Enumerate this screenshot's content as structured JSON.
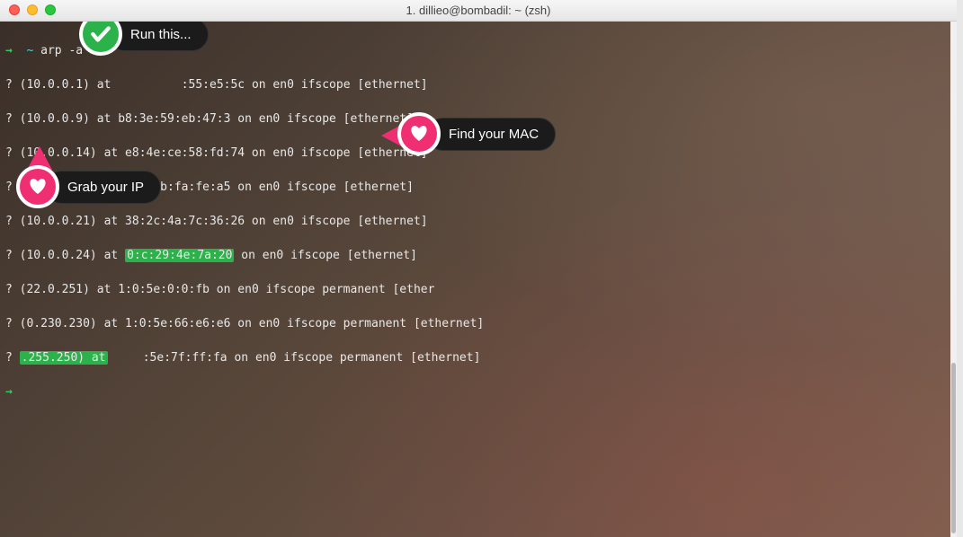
{
  "window": {
    "title": "1. dillieo@bombadil: ~ (zsh)"
  },
  "prompt": {
    "arrow": "→",
    "path": "~",
    "command": "arp -a"
  },
  "output": [
    {
      "raw": "? (10.0.0.1) at ",
      "mac": "",
      "tail": ":55:e5:5c on en0 ifscope [ethernet]"
    },
    {
      "raw": "? (10.0.0.9) at b8:3e:59:eb:47:3 on en0 ifscope [ethernet]"
    },
    {
      "raw": "? (10.0.0.14) at e8:4e:ce:58:fd:74 on en0 ifscope [ethernet]"
    },
    {
      "raw": "? (10.0.0.16) at 0:d:4b:fa:fe:a5 on en0 ifscope [ethernet]"
    },
    {
      "raw": "? (10.0.0.21) at 38:2c:4a:7c:36:26 on en0 ifscope [ethernet]"
    },
    {
      "raw": "? (10.0.0.24) at ",
      "macHl": "0:c:29:4e:7a:20",
      "tail2": " on en0 ifscope [ethernet]"
    },
    {
      "raw": "? (22",
      "ipUnder": ".0.251) at 1:0:5e:0:0:fb on en0 ifscope permanent [eth",
      "tail3": "er"
    },
    {
      "raw": "? (",
      "ipUnder2": "0.230.230) at 1:0:5e:66:e6:e6 on en0 ifscope permanent [ethernet]"
    },
    {
      "raw": "? ",
      "ipSpace": "             ",
      "tail4": ":5e:7f:ff:fa on en0 ifscope permanent [ethernet]"
    }
  ],
  "annotations": {
    "run": "Run this...",
    "mac": "Find your MAC",
    "ip": "Grab your IP"
  },
  "highlight": {
    "mac": "0:c:29:4e:7a:20",
    "ipFragment": ".255.250) at"
  }
}
